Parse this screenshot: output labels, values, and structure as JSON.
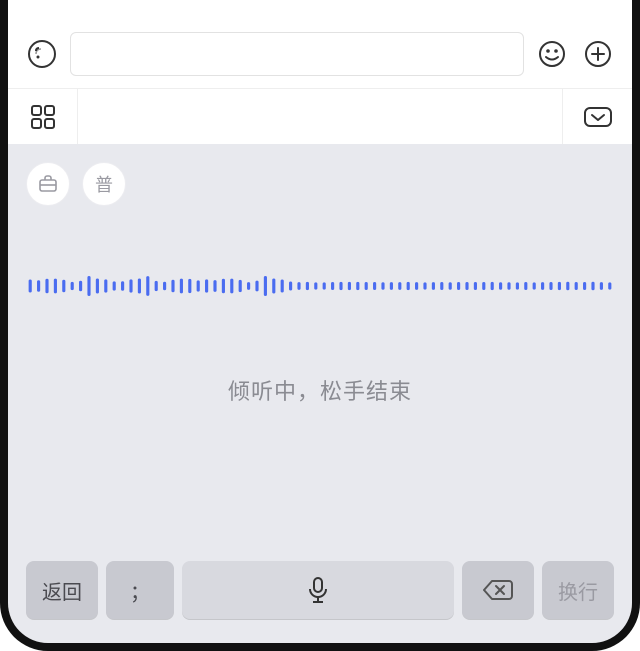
{
  "input_bar": {
    "voice_icon": "voice-wave-icon",
    "emoji_icon": "emoji-icon",
    "plus_icon": "plus-icon"
  },
  "keyboard_topbar": {
    "apps_icon": "apps-grid-icon",
    "collapse_icon": "chevron-down-icon"
  },
  "voice_panel": {
    "briefcase_icon": "briefcase-icon",
    "language_pill": "普",
    "status": "倾听中，松手结束"
  },
  "keys": {
    "return": "返回",
    "punct": "；",
    "mic_icon": "microphone-icon",
    "delete_icon": "backspace-icon",
    "newline": "换行"
  },
  "colors": {
    "wave": "#4a6cf0",
    "panel_bg": "#e8e9ee",
    "key_bg": "#c8c9d0"
  }
}
